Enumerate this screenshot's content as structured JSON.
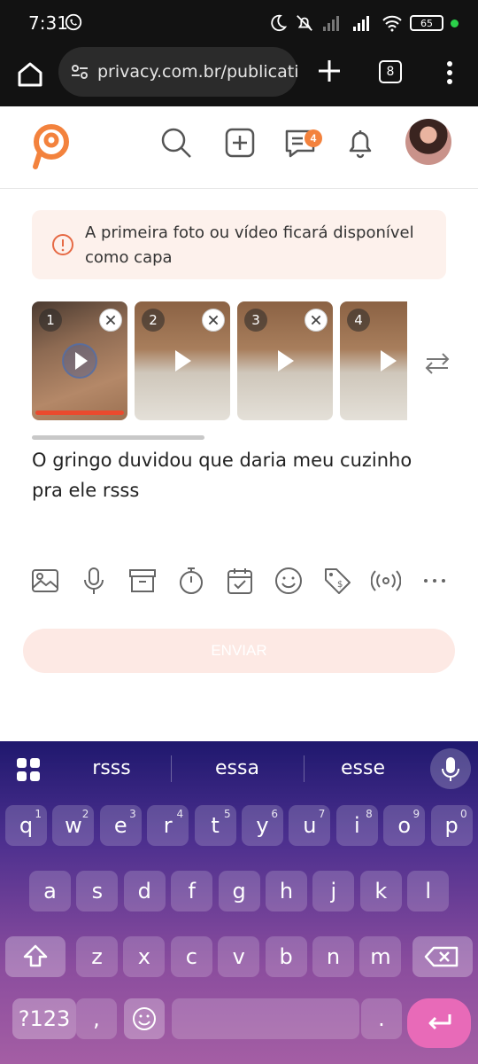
{
  "status_bar": {
    "time": "7:31",
    "battery": "65"
  },
  "browser": {
    "url": "privacy.com.br/publication",
    "tab_count": "8"
  },
  "header": {
    "message_badge": "4"
  },
  "notice": {
    "text": "A primeira foto ou vídeo ficará disponível como capa"
  },
  "media": {
    "thumbs": [
      {
        "number": "1"
      },
      {
        "number": "2"
      },
      {
        "number": "3"
      },
      {
        "number": "4"
      }
    ]
  },
  "post": {
    "caption": "O gringo duvidou que daria meu cuzinho pra ele rsss"
  },
  "toolbar": {
    "tools": [
      "image-icon",
      "mic-icon",
      "archive-icon",
      "timer-icon",
      "calendar-icon",
      "emoji-icon",
      "price-tag-icon",
      "live-icon",
      "more-icon"
    ]
  },
  "send": {
    "label": "ENVIAR"
  },
  "keyboard": {
    "suggestions": [
      "rsss",
      "essa",
      "esse"
    ],
    "row1": [
      {
        "k": "q",
        "h": "1"
      },
      {
        "k": "w",
        "h": "2"
      },
      {
        "k": "e",
        "h": "3"
      },
      {
        "k": "r",
        "h": "4"
      },
      {
        "k": "t",
        "h": "5"
      },
      {
        "k": "y",
        "h": "6"
      },
      {
        "k": "u",
        "h": "7"
      },
      {
        "k": "i",
        "h": "8"
      },
      {
        "k": "o",
        "h": "9"
      },
      {
        "k": "p",
        "h": "0"
      }
    ],
    "row2": [
      "a",
      "s",
      "d",
      "f",
      "g",
      "h",
      "j",
      "k",
      "l"
    ],
    "row3": [
      "z",
      "x",
      "c",
      "v",
      "b",
      "n",
      "m"
    ],
    "symbols_key": "?123",
    "comma_key": ",",
    "period_key": "."
  },
  "colors": {
    "brand": "#f3823d",
    "send_disabled": "#fde9e4",
    "progress": "#ea4a2e"
  }
}
